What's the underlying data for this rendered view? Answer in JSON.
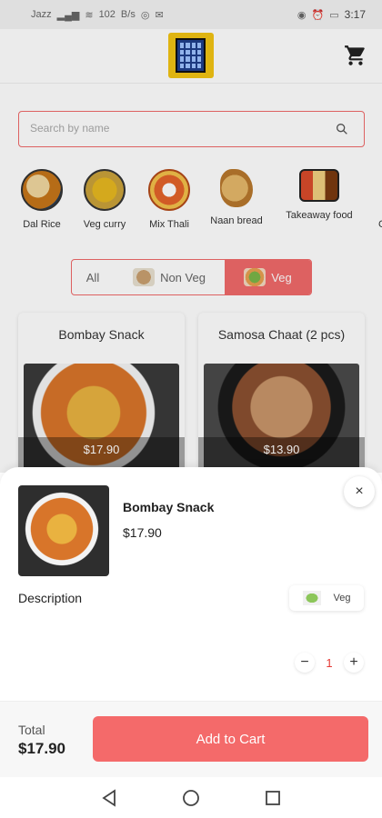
{
  "status_bar": {
    "time": "3:17",
    "network_speed": "102",
    "network_unit": "B/s",
    "left_text": "Jazz"
  },
  "header": {
    "logo_icon": "building-logo-icon",
    "cart_icon": "shopping-cart-icon"
  },
  "search": {
    "placeholder": "Search by name",
    "value": ""
  },
  "categories": [
    {
      "label": "Dal Rice"
    },
    {
      "label": "Veg curry"
    },
    {
      "label": "Mix Thali"
    },
    {
      "label": "Naan bread"
    },
    {
      "label": "Takeaway food"
    },
    {
      "label": "C"
    }
  ],
  "filter": {
    "all": "All",
    "non_veg": "Non Veg",
    "veg": "Veg",
    "selected": "Veg"
  },
  "products": [
    {
      "name": "Bombay Snack",
      "price": "$17.90"
    },
    {
      "name": "Samosa Chaat (2 pcs)",
      "price": "$13.90"
    }
  ],
  "detail": {
    "name": "Bombay Snack",
    "price": "$17.90",
    "description_label": "Description",
    "veg_label": "Veg",
    "quantity": "1",
    "minus": "−",
    "plus": "+",
    "close": "×"
  },
  "footer": {
    "total_label": "Total",
    "total_value": "$17.90",
    "add_label": "Add to Cart"
  },
  "colors": {
    "accent": "#f06a6a",
    "button": "#f46a6a",
    "quantity": "#e53935"
  }
}
